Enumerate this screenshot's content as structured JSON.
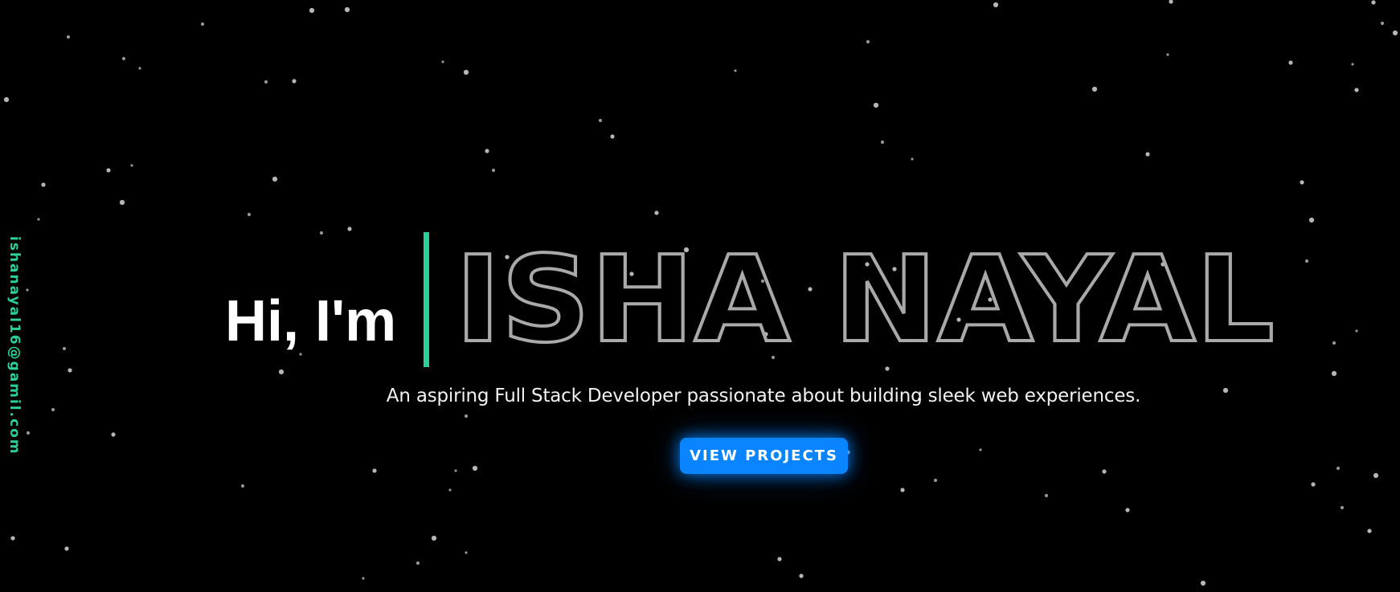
{
  "colors": {
    "background": "#000000",
    "accent": "#2ccf9a",
    "button": "#0a84ff",
    "name_outline": "#a9a9a9",
    "star": "#d6d6d6"
  },
  "side": {
    "email": "ishanayal16@gamil.com"
  },
  "hero": {
    "greeting": "Hi, I'm",
    "name": "ISHA NAYAL",
    "tagline": "An aspiring Full Stack Developer passionate about building sleek web experiences.",
    "cta_label": "VIEW PROJECTS"
  }
}
